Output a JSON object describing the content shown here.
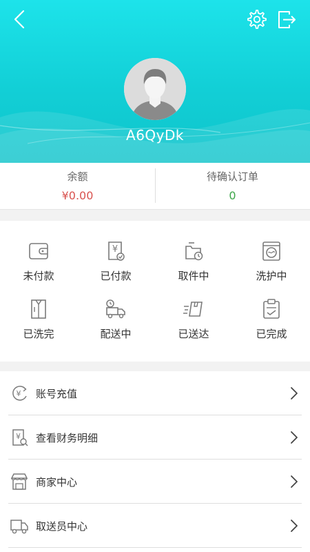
{
  "profile": {
    "username": "A6QyDk"
  },
  "stats": {
    "balance_label": "余额",
    "balance_value": "¥0.00",
    "pending_label": "待确认订单",
    "pending_value": "0"
  },
  "orders": [
    {
      "label": "未付款",
      "icon": "wallet-icon"
    },
    {
      "label": "已付款",
      "icon": "paid-receipt-icon"
    },
    {
      "label": "取件中",
      "icon": "pickup-clock-icon"
    },
    {
      "label": "洗护中",
      "icon": "washing-machine-icon"
    },
    {
      "label": "已洗完",
      "icon": "shirt-icon"
    },
    {
      "label": "配送中",
      "icon": "delivery-truck-icon"
    },
    {
      "label": "已送达",
      "icon": "delivered-box-icon"
    },
    {
      "label": "已完成",
      "icon": "completed-clipboard-icon"
    }
  ],
  "menu": [
    {
      "label": "账号充值",
      "icon": "recharge-icon"
    },
    {
      "label": "查看财务明细",
      "icon": "finance-detail-icon"
    },
    {
      "label": "商家中心",
      "icon": "store-icon"
    },
    {
      "label": "取送员中心",
      "icon": "courier-truck-icon"
    }
  ],
  "colors": {
    "header": "#12cfd6",
    "balance": "#d9534f",
    "pending": "#3ea64a",
    "icon": "#7a7a7a"
  }
}
